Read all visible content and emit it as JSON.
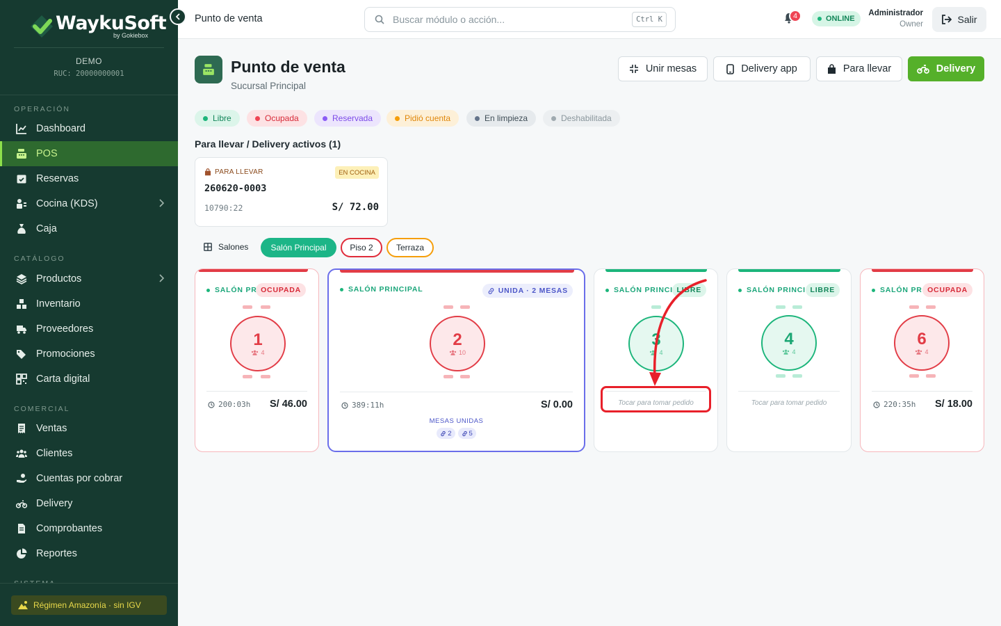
{
  "brand": {
    "name": "WaykuSoft",
    "sub": "by Gokiebox"
  },
  "company": {
    "name": "DEMO",
    "ruc": "RUC: 20000000001"
  },
  "sidebar": {
    "sections": [
      {
        "label": "OPERACIÓN"
      },
      {
        "label": "CATÁLOGO"
      },
      {
        "label": "COMERCIAL"
      },
      {
        "label": "SISTEMA"
      }
    ],
    "items": [
      {
        "label": "Dashboard",
        "icon": "chart-line-icon"
      },
      {
        "label": "POS",
        "icon": "cash-register-icon",
        "active": true
      },
      {
        "label": "Reservas",
        "icon": "calendar-check-icon"
      },
      {
        "label": "Cocina (KDS)",
        "icon": "kitchen-icon",
        "has_children": true
      },
      {
        "label": "Caja",
        "icon": "money-bag-icon"
      },
      {
        "label": "Productos",
        "icon": "layers-icon",
        "has_children": true
      },
      {
        "label": "Inventario",
        "icon": "boxes-icon"
      },
      {
        "label": "Proveedores",
        "icon": "truck-icon"
      },
      {
        "label": "Promociones",
        "icon": "tags-icon"
      },
      {
        "label": "Carta digital",
        "icon": "qr-code-icon"
      },
      {
        "label": "Ventas",
        "icon": "receipt-icon"
      },
      {
        "label": "Clientes",
        "icon": "users-icon"
      },
      {
        "label": "Cuentas por cobrar",
        "icon": "hand-money-icon"
      },
      {
        "label": "Delivery",
        "icon": "motorcycle-icon"
      },
      {
        "label": "Comprobantes",
        "icon": "document-icon"
      },
      {
        "label": "Reportes",
        "icon": "pie-chart-icon"
      }
    ],
    "regimen": "Régimen Amazonía · sin IGV"
  },
  "topbar": {
    "title": "Punto de venta",
    "search_placeholder": "Buscar módulo o acción...",
    "shortcut": "Ctrl K",
    "notifications": "4",
    "status": "ONLINE",
    "user_name": "Administrador",
    "user_role": "Owner",
    "logout": "Salir"
  },
  "page": {
    "title": "Punto de venta",
    "subtitle": "Sucursal Principal",
    "actions": [
      "Unir mesas",
      "Delivery app",
      "Para llevar",
      "Delivery"
    ]
  },
  "legend": [
    {
      "label": "Libre",
      "color": "#1cb57b"
    },
    {
      "label": "Ocupada",
      "color": "#ef4454"
    },
    {
      "label": "Reservada",
      "color": "#8b5cf6"
    },
    {
      "label": "Pidió cuenta",
      "color": "#f59e0b"
    },
    {
      "label": "En limpieza",
      "color": "#64748b"
    },
    {
      "label": "Deshabilitada",
      "color": "#a0aab0"
    }
  ],
  "active_orders": {
    "title": "Para llevar / Delivery activos (1)",
    "orders": [
      {
        "type": "PARA LLEVAR",
        "status": "EN COCINA",
        "code": "260620-0003",
        "time": "10790:22",
        "total": "S/ 72.00"
      }
    ]
  },
  "salons": {
    "label": "Salones",
    "tabs": [
      "Salón Principal",
      "Piso 2",
      "Terraza"
    ]
  },
  "tables": [
    {
      "salon": "SALÓN PR",
      "badge": "OCUPADA",
      "number": "1",
      "capacity": "4",
      "time": "200:03h",
      "total": "S/ 46.00"
    },
    {
      "salon": "SALÓN PRINCIPAL",
      "badge": "UNIDA · 2 MESAS",
      "number": "2",
      "capacity": "10",
      "time": "389:11h",
      "total": "S/ 0.00",
      "merged_label": "MESAS UNIDAS",
      "merged": [
        "2",
        "5"
      ]
    },
    {
      "salon": "SALÓN PRINCI",
      "badge": "LIBRE",
      "number": "3",
      "capacity": "4",
      "hint": "Tocar para tomar pedido"
    },
    {
      "salon": "SALÓN PRINCI",
      "badge": "LIBRE",
      "number": "4",
      "capacity": "4",
      "hint": "Tocar para tomar pedido"
    },
    {
      "salon": "SALÓN PR",
      "badge": "OCUPADA",
      "number": "6",
      "capacity": "4",
      "time": "220:35h",
      "total": "S/ 18.00"
    }
  ]
}
